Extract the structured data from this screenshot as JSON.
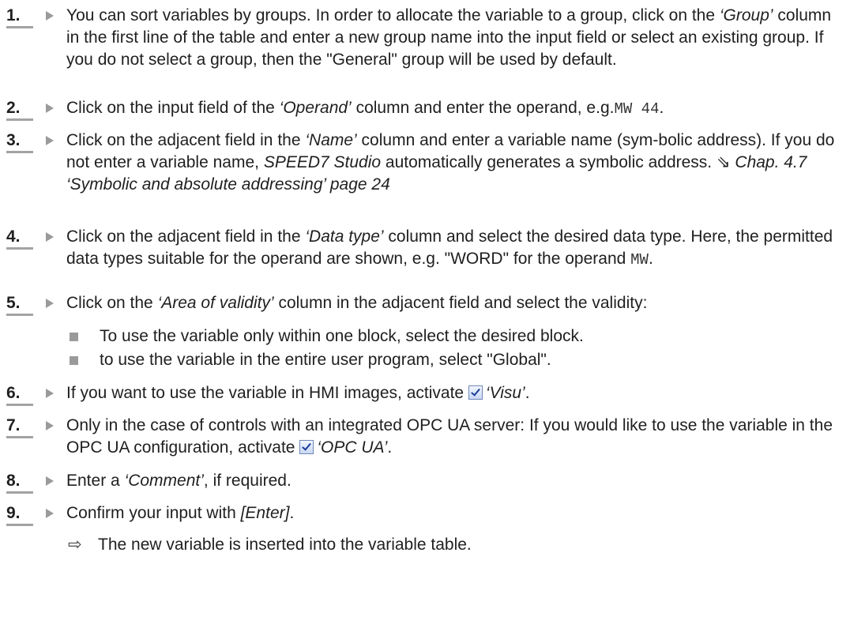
{
  "steps": [
    {
      "number": "1.",
      "parts": [
        "You can sort variables by groups. In order to allocate the variable to a group, click on the ",
        "‘Group’",
        " column in the first line of the table and enter a new group name into the input field or select an existing group. If you do not select a group, then the \"General\" group will be used by default."
      ]
    },
    {
      "number": "2.",
      "parts": [
        "Click on the input field of the ",
        "‘Operand’",
        " column and enter the operand, e.g.",
        "MW 44",
        "."
      ]
    },
    {
      "number": "3.",
      "parts": [
        "Click on the adjacent field in the ",
        "‘Name’",
        " column and enter a variable name (sym-bolic address). If you do not enter a variable name, ",
        "SPEED7 Studio",
        " automatically generates a symbolic address. ",
        "⇘ ",
        "Chap. 4.7 ‘Symbolic and absolute addressing’ page 24"
      ]
    },
    {
      "number": "4.",
      "parts": [
        "Click on the adjacent field in the ",
        "‘Data type’",
        " column and select the desired data type. Here, the permitted data types suitable for the operand are shown, e.g. \"WORD\" for the operand ",
        "MW",
        "."
      ]
    },
    {
      "number": "5.",
      "parts": [
        "Click on the ",
        "‘Area of validity’",
        " column in the adjacent field and select the validity:"
      ],
      "bullets": [
        "To use the variable only within one block, select the desired block.",
        "to use the variable in the entire user program, select \"Global\"."
      ]
    },
    {
      "number": "6.",
      "parts": [
        "If you want to use the variable in HMI images, activate ",
        "‘Visu’",
        "."
      ]
    },
    {
      "number": "7.",
      "parts": [
        "Only in the case of controls with an integrated OPC UA server: If you would like to use the variable in the OPC UA configuration, activate ",
        "‘OPC UA’",
        "."
      ]
    },
    {
      "number": "8.",
      "parts": [
        "Enter a ",
        "‘Comment’",
        ", if required."
      ]
    },
    {
      "number": "9.",
      "parts": [
        "Confirm your input with ",
        "[Enter]",
        "."
      ],
      "result": "The new variable is inserted into the variable table."
    }
  ],
  "icons": {
    "step_marker": "triangle-right-icon",
    "checkbox": "checked-checkbox-icon",
    "result_arrow": "result-arrow-icon",
    "bullet": "square-bullet-icon",
    "cross_ref": "cross-reference-icon"
  },
  "colors": {
    "text": "#1f1f1f",
    "underline": "#a3a3a3",
    "marker": "#9a9a9a",
    "checkbox_border": "#6f87b8"
  },
  "result_arrow_glyph": "⇨"
}
